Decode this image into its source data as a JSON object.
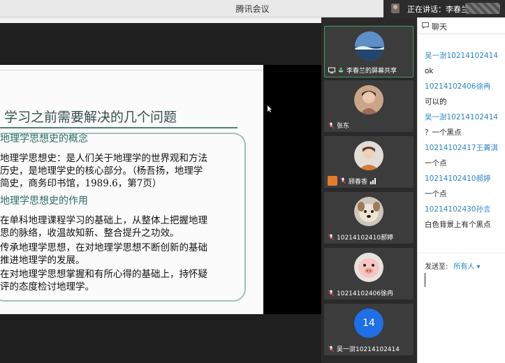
{
  "app": {
    "title": "腾讯会议"
  },
  "speaking": {
    "text": "正在讲话：李春兰;"
  },
  "slide": {
    "title": "学习之前需要解决的几个问题",
    "lines": [
      "地理学思想史的概念",
      "地理学思想史：是人们关于地理学的世界观和方法",
      "历史，是地理学史的核心部分。（杨吾扬，地理学",
      "简史，商务印书馆，1989.6，第7页）",
      "地理学思想史的作用",
      "在单科地理课程学习的基础上，从整体上把握地理",
      "思的脉络，收温故知新、整合提升之功效。",
      "传承地理学思想，在对地理学思想不断创新的基础",
      "推进地理学的发展。",
      "在对地理学思想掌握和有所心得的基础上，持怀疑",
      "评的态度检讨地理学。"
    ]
  },
  "participants": [
    {
      "name": "李春兰的屏幕共享",
      "avatar": "landscape-photo"
    },
    {
      "name": "张东",
      "avatar": "portrait-photo"
    },
    {
      "name": "顾春香",
      "avatar": "person-photo"
    },
    {
      "name": "10214102410郝婷",
      "avatar": "dog-photo"
    },
    {
      "name": "10214102406徐冉",
      "avatar": "pig-photo"
    },
    {
      "name": "吴一澍10214102414",
      "avatar_text": "14"
    }
  ],
  "chat": {
    "title": "聊天",
    "messages": [
      {
        "sender": "吴一澍10214102414",
        "text": "ok"
      },
      {
        "sender": "10214102406徐冉",
        "text": "可以的"
      },
      {
        "sender": "吴一澍10214102414",
        "text": "？一个黑点"
      },
      {
        "sender": "10214102417王菁淇",
        "text": "一个点"
      },
      {
        "sender": "10214102410郝婷",
        "text": "一个点"
      },
      {
        "sender": "10214102430孙言",
        "text": "白色背景上有个黑点"
      }
    ],
    "send_to_label": "发送至:",
    "send_to_target": "所有人 ▾"
  },
  "colors": {
    "accent": "#2a86c7",
    "active_border": "#3f9f5b",
    "slide_heading": "#2e6e64"
  }
}
